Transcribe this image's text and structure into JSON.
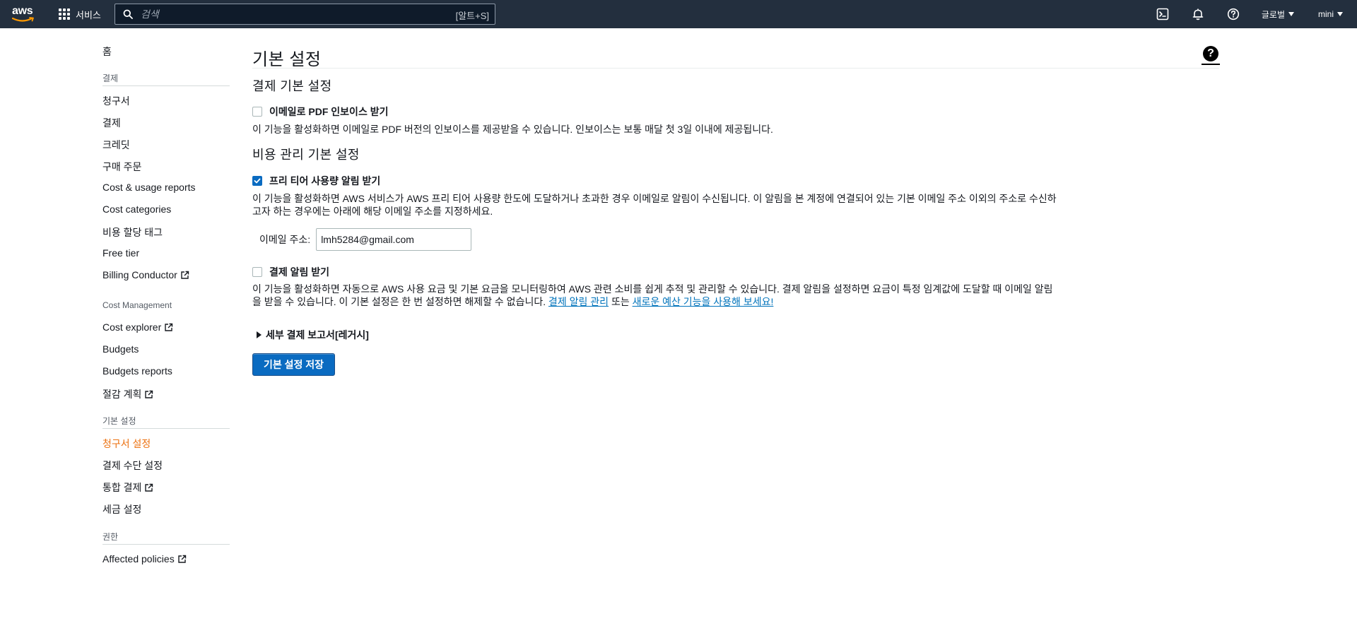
{
  "topnav": {
    "logo_text": "aws",
    "services_label": "서비스",
    "search_placeholder": "검색",
    "search_shortcut": "[알트+S]",
    "region_label": "글로벌",
    "user_label": "mini",
    "icons": [
      "cloudshell-icon",
      "bell-icon",
      "help-icon"
    ]
  },
  "sidebar": {
    "home": "홈",
    "billing_header": "결제",
    "billing_items": [
      "청구서",
      "결제",
      "크레딧",
      "구매 주문",
      "Cost & usage reports",
      "Cost categories",
      "비용 할당 태그",
      "Free tier",
      "Billing Conductor"
    ],
    "cost_mgmt_header": "Cost Management",
    "cost_mgmt_items": [
      "Cost explorer",
      "Budgets",
      "Budgets reports",
      "절감 계획"
    ],
    "prefs_header": "기본 설정",
    "prefs_items": [
      "청구서 설정",
      "결제 수단 설정",
      "통합 결제",
      "세금 설정"
    ],
    "perms_header": "권한",
    "perms_items": [
      "Affected policies"
    ],
    "active_color": "#ec7211"
  },
  "main": {
    "title": "기본 설정",
    "billing_section_title": "결제 기본 설정",
    "pdf_invoice": {
      "label": "이메일로 PDF 인보이스 받기",
      "checked": false,
      "desc": "이 기능을 활성화하면 이메일로 PDF 버전의 인보이스를 제공받을 수 있습니다. 인보이스는 보통 매달 첫 3일 이내에 제공됩니다."
    },
    "cost_section_title": "비용 관리 기본 설정",
    "free_tier_alert": {
      "label": "프리 티어 사용량 알림 받기",
      "checked": true,
      "desc": "이 기능을 활성화하면 AWS 서비스가 AWS 프리 티어 사용량 한도에 도달하거나 초과한 경우 이메일로 알림이 수신됩니다. 이 알림을 본 계정에 연결되어 있는 기본 이메일 주소 이외의 주소로 수신하고자 하는 경우에는 아래에 해당 이메일 주소를 지정하세요.",
      "email_label": "이메일 주소:",
      "email_value": "lmh5284@gmail.com"
    },
    "billing_alert": {
      "label": "결제 알림 받기",
      "checked": false,
      "desc": "이 기능을 활성화하면 자동으로 AWS 사용 요금 및 기본 요금을 모니터링하여 AWS 관련 소비를 쉽게 추적 및 관리할 수 있습니다. 결제 알림을 설정하면 요금이 특정 임계값에 도달할 때 이메일 알림을 받을 수 있습니다. 이 기본 설정은 한 번 설정하면 해제할 수 없습니다.",
      "link1": "결제 알림 관리",
      "joiner": "또는",
      "link2": "새로운 예산 기능을 사용해 보세요!"
    },
    "detail_report_label": "세부 결제 보고서[레거시]",
    "save_label": "기본 설정 저장"
  },
  "colors": {
    "nav_bg": "#232f3e",
    "primary": "#0a6bc1",
    "link": "#0073bb"
  }
}
